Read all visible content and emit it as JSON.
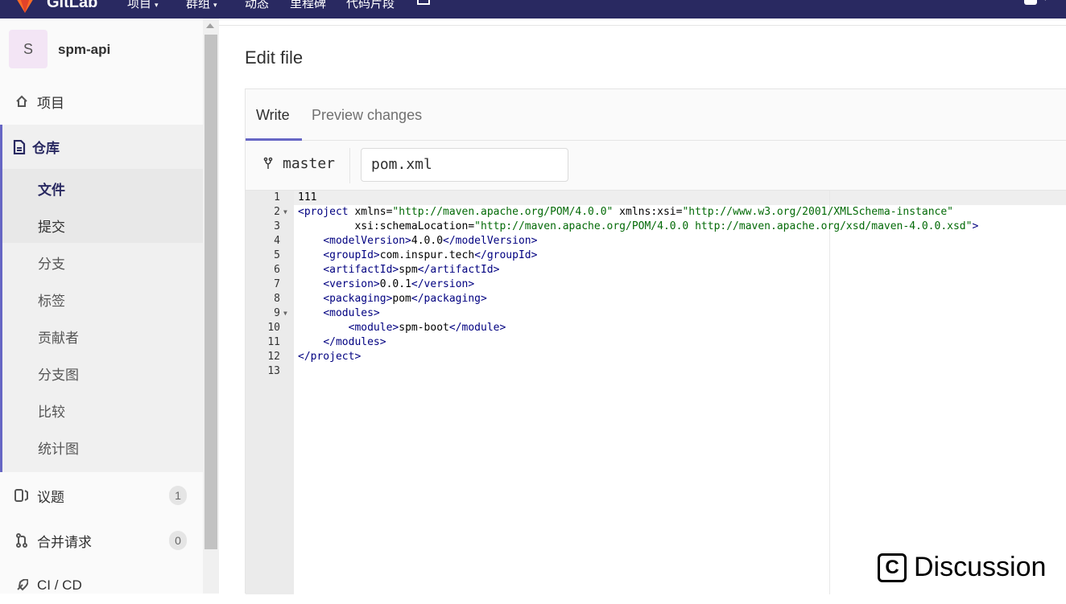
{
  "navbar": {
    "logo_text": "GitLab",
    "items": [
      {
        "label": "项目",
        "caret": "▾"
      },
      {
        "label": "群组",
        "caret": "▾"
      },
      {
        "label": "动态",
        "caret": ""
      },
      {
        "label": "里程碑",
        "caret": ""
      },
      {
        "label": "代码片段",
        "caret": ""
      }
    ]
  },
  "sidebar": {
    "project_initial": "S",
    "project_name": "spm-api",
    "project_item": "项目",
    "repo_label": "仓库",
    "repo_sub": [
      "文件",
      "提交",
      "分支",
      "标签",
      "贡献者",
      "分支图",
      "比较",
      "统计图"
    ],
    "issues_label": "议题",
    "issues_count": "1",
    "merge_label": "合并请求",
    "merge_count": "0",
    "cicd_label": "CI / CD"
  },
  "page": {
    "title": "Edit file"
  },
  "editor": {
    "tab_write": "Write",
    "tab_preview": "Preview changes",
    "branch": "master",
    "file_name": "pom.xml",
    "lines": [
      {
        "n": "1",
        "fold": false,
        "tokens": [
          [
            "txt",
            "111"
          ]
        ]
      },
      {
        "n": "2",
        "fold": true,
        "tokens": [
          [
            "tag",
            "<project"
          ],
          [
            "attr",
            " xmlns="
          ],
          [
            "str",
            "\"http://maven.apache.org/POM/4.0.0\""
          ],
          [
            "attr",
            " xmlns:xsi="
          ],
          [
            "str",
            "\"http://www.w3.org/2001/XMLSchema-instance\""
          ]
        ]
      },
      {
        "n": "3",
        "fold": false,
        "tokens": [
          [
            "attr",
            "         xsi:schemaLocation="
          ],
          [
            "str",
            "\"http://maven.apache.org/POM/4.0.0 http://maven.apache.org/xsd/maven-4.0.0.xsd\""
          ],
          [
            "tag",
            ">"
          ]
        ]
      },
      {
        "n": "4",
        "fold": false,
        "tokens": [
          [
            "txt",
            "    "
          ],
          [
            "tag",
            "<modelVersion>"
          ],
          [
            "txt",
            "4.0.0"
          ],
          [
            "tag",
            "</modelVersion>"
          ]
        ]
      },
      {
        "n": "5",
        "fold": false,
        "tokens": [
          [
            "txt",
            "    "
          ],
          [
            "tag",
            "<groupId>"
          ],
          [
            "txt",
            "com.inspur.tech"
          ],
          [
            "tag",
            "</groupId>"
          ]
        ]
      },
      {
        "n": "6",
        "fold": false,
        "tokens": [
          [
            "txt",
            "    "
          ],
          [
            "tag",
            "<artifactId>"
          ],
          [
            "txt",
            "spm"
          ],
          [
            "tag",
            "</artifactId>"
          ]
        ]
      },
      {
        "n": "7",
        "fold": false,
        "tokens": [
          [
            "txt",
            "    "
          ],
          [
            "tag",
            "<version>"
          ],
          [
            "txt",
            "0.0.1"
          ],
          [
            "tag",
            "</version>"
          ]
        ]
      },
      {
        "n": "8",
        "fold": false,
        "tokens": [
          [
            "txt",
            "    "
          ],
          [
            "tag",
            "<packaging>"
          ],
          [
            "txt",
            "pom"
          ],
          [
            "tag",
            "</packaging>"
          ]
        ]
      },
      {
        "n": "9",
        "fold": true,
        "tokens": [
          [
            "txt",
            "    "
          ],
          [
            "tag",
            "<modules>"
          ]
        ]
      },
      {
        "n": "10",
        "fold": false,
        "tokens": [
          [
            "txt",
            "        "
          ],
          [
            "tag",
            "<module>"
          ],
          [
            "txt",
            "spm-boot"
          ],
          [
            "tag",
            "</module>"
          ]
        ]
      },
      {
        "n": "11",
        "fold": false,
        "tokens": [
          [
            "txt",
            "    "
          ],
          [
            "tag",
            "</modules>"
          ]
        ]
      },
      {
        "n": "12",
        "fold": false,
        "tokens": [
          [
            "tag",
            "</project>"
          ]
        ]
      },
      {
        "n": "13",
        "fold": false,
        "tokens": []
      }
    ]
  },
  "watermark": {
    "icon_letter": "C",
    "text": "Discussion"
  },
  "colors": {
    "navbar": "#292961",
    "accent": "#6666c4",
    "logo": "#fc6d26"
  }
}
